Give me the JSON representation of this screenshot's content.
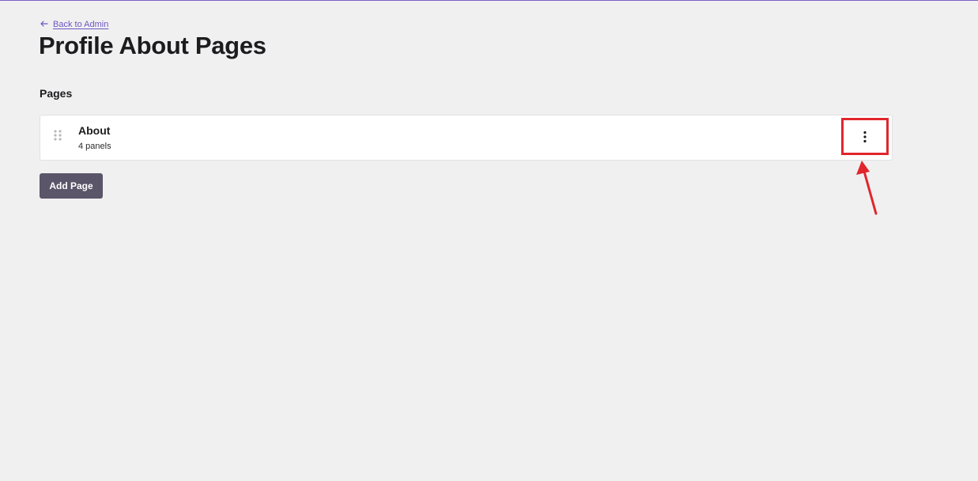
{
  "nav": {
    "back_label": "Back to Admin",
    "back_icon": "arrow-left-icon"
  },
  "header": {
    "title": "Profile About Pages"
  },
  "pages_section": {
    "heading": "Pages",
    "items": [
      {
        "name": "About",
        "meta": "4 panels",
        "drag_icon": "drag-handle-icon",
        "menu_icon": "more-vertical-icon"
      }
    ],
    "add_label": "Add Page"
  },
  "colors": {
    "accent": "#6e55c0",
    "highlight": "#e0262c",
    "button_bg": "#5a5568",
    "page_bg": "#f0f0f1"
  }
}
